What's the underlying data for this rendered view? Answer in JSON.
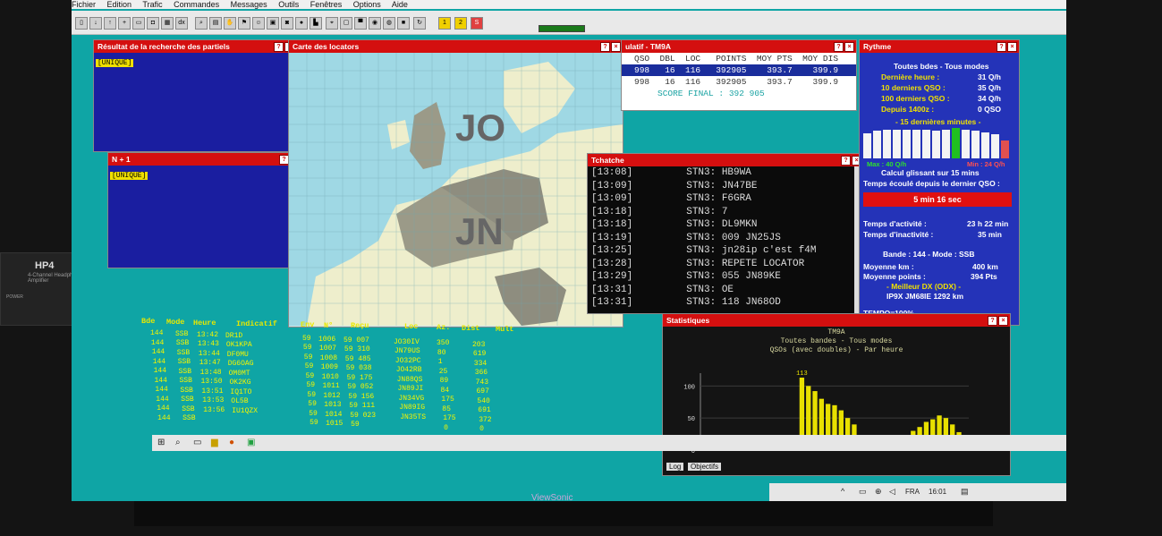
{
  "menu": [
    "Fichier",
    "Edition",
    "Trafic",
    "Commandes",
    "Messages",
    "Outils",
    "Fenêtres",
    "Options",
    "Aide"
  ],
  "amp": {
    "brand": "HP4",
    "subtitle": "4-Channel Headphone Amplifier",
    "power": "POWER"
  },
  "monitor_brand": "ViewSonic",
  "partials": {
    "title": "Résultat de la recherche des partiels",
    "tag": "[UNIQUE]"
  },
  "nplus1": {
    "title": "N + 1",
    "tag": "[UNIQUE]"
  },
  "map": {
    "title": "Carte des locators",
    "labels": [
      "JO",
      "JN"
    ]
  },
  "cumul": {
    "title": "ulatif - TM9A",
    "header": "QSO  DBL  LOC   POINTS  MOY PTS  MOY DIS",
    "rows": [
      "998   16  116   392905    393.7    399.9",
      "998   16  116   392905    393.7    399.9"
    ],
    "score": "SCORE FINAL : 392 905"
  },
  "chat": {
    "title": "Tchatche",
    "lines": [
      {
        "time": "[13:08]",
        "text": "STN3: HB9WA"
      },
      {
        "time": "[13:09]",
        "text": "STN3: JN47BE"
      },
      {
        "time": "[13:09]",
        "text": "STN3: F6GRA"
      },
      {
        "time": "[13:18]",
        "text": "STN3: 7"
      },
      {
        "time": "[13:18]",
        "text": "STN3: DL9MKN"
      },
      {
        "time": "[13:19]",
        "text": "STN3: 009 JN25JS"
      },
      {
        "time": "[13:25]",
        "text": "STN3: jn28ip c'est f4M"
      },
      {
        "time": "[13:28]",
        "text": "STN3: REPETE LOCATOR"
      },
      {
        "time": "[13:29]",
        "text": "STN3: 055 JN89KE"
      },
      {
        "time": "[13:31]",
        "text": "STN3: OE"
      },
      {
        "time": "[13:31]",
        "text": "STN3: 118 JN68OD"
      }
    ]
  },
  "rythme": {
    "title": "Rythme",
    "subtitle": "Toutes bdes - Tous modes",
    "stats": [
      {
        "label": "Dernière heure :",
        "value": "31 Q/h"
      },
      {
        "label": "10 derniers QSO :",
        "value": "35 Q/h"
      },
      {
        "label": "100 derniers QSO :",
        "value": "34 Q/h"
      },
      {
        "label": "Depuis 1400z :",
        "value": "0 QSO"
      }
    ],
    "last15": "- 15 dernières minutes -",
    "bars": [
      0.78,
      0.85,
      0.88,
      0.9,
      0.9,
      0.9,
      0.88,
      0.85,
      0.9,
      0.95,
      0.9,
      0.85,
      0.8,
      0.75,
      0.55
    ],
    "max": "Max : 40 Q/h",
    "min": "Min : 24 Q/h",
    "calc": "Calcul glissant sur 15 mins",
    "elapsed_label": "Temps écoulé depuis le dernier QSO :",
    "elapsed_value": "5 min 16 sec",
    "activity_label": "Temps d'activité :",
    "activity_value": "23 h 22 min",
    "inactivity_label": "Temps d'inactivité :",
    "inactivity_value": "35 min",
    "band": "Bande : 144 - Mode : SSB",
    "avg_km_label": "Moyenne km :",
    "avg_km_value": "400 km",
    "avg_pts_label": "Moyenne points :",
    "avg_pts_value": "394 Pts",
    "best_label": "- Meilleur DX (ODX) -",
    "best_value": "IP9X  JM68IE  1292 km",
    "tempo": "TEMPO=100%"
  },
  "log": {
    "headers": [
      "Bde",
      "Mode",
      "Heure",
      "Indicatif",
      "Env",
      "N°",
      "Reçu",
      "Loc",
      "Az.",
      "Dist",
      "Mult"
    ],
    "rows": [
      {
        "bde": "144",
        "mode": "SSB",
        "heure": "13:42",
        "call": "DR1D",
        "env": "59",
        "n": "1006",
        "recu": "59 007",
        "loc": "JO30IV",
        "az": "350",
        "dist": "203"
      },
      {
        "bde": "144",
        "mode": "SSB",
        "heure": "13:43",
        "call": "OK1KPA",
        "env": "59",
        "n": "1007",
        "recu": "59 310",
        "loc": "JN79US",
        "az": "80",
        "dist": "619"
      },
      {
        "bde": "144",
        "mode": "SSB",
        "heure": "13:44",
        "call": "DF0MU",
        "env": "59",
        "n": "1008",
        "recu": "59 485",
        "loc": "JO32PC",
        "az": "1",
        "dist": "334"
      },
      {
        "bde": "144",
        "mode": "SSB",
        "heure": "13:47",
        "call": "DG6OAG",
        "env": "59",
        "n": "1009",
        "recu": "59 038",
        "loc": "JO42RB",
        "az": "25",
        "dist": "366"
      },
      {
        "bde": "144",
        "mode": "SSB",
        "heure": "13:48",
        "call": "OM0MT",
        "env": "59",
        "n": "1010",
        "recu": "59 175",
        "loc": "JN88QS",
        "az": "89",
        "dist": "743"
      },
      {
        "bde": "144",
        "mode": "SSB",
        "heure": "13:50",
        "call": "OK2KG",
        "env": "59",
        "n": "1011",
        "recu": "59 052",
        "loc": "JN89JI",
        "az": "84",
        "dist": "697"
      },
      {
        "bde": "144",
        "mode": "SSB",
        "heure": "13:51",
        "call": "IQ1TO",
        "env": "59",
        "n": "1012",
        "recu": "59 156",
        "loc": "JN34VG",
        "az": "175",
        "dist": "540"
      },
      {
        "bde": "144",
        "mode": "SSB",
        "heure": "13:53",
        "call": "OL5B",
        "env": "59",
        "n": "1013",
        "recu": "59 111",
        "loc": "JN89IG",
        "az": "85",
        "dist": "691"
      },
      {
        "bde": "144",
        "mode": "SSB",
        "heure": "13:56",
        "call": "IU1QZX",
        "env": "59",
        "n": "1014",
        "recu": "59 023",
        "loc": "JN35TS",
        "az": "175",
        "dist": "372"
      },
      {
        "bde": "144",
        "mode": "SSB",
        "heure": "",
        "call": "",
        "env": "59",
        "n": "1015",
        "recu": "59",
        "loc": "",
        "az": "0",
        "dist": "0"
      }
    ]
  },
  "stats": {
    "title": "Statistiques",
    "chart_title": "TM9A",
    "chart_sub1": "Toutes bandes - Tous modes",
    "chart_sub2": "QSOs (avec doubles) - Par heure",
    "peak_label": "113",
    "tabs": [
      "Log",
      "Objectifs"
    ]
  },
  "chart_data": {
    "type": "bar",
    "title": "TM9A",
    "ylim": [
      0,
      120
    ],
    "yticks": [
      0,
      50,
      100
    ],
    "values": [
      0,
      0,
      0,
      0,
      0,
      0,
      0,
      0,
      0,
      0,
      0,
      0,
      0,
      0,
      0,
      113,
      100,
      92,
      80,
      72,
      70,
      62,
      50,
      40,
      22,
      12,
      18,
      8,
      14,
      12,
      16,
      22,
      30,
      36,
      44,
      48,
      54,
      50,
      40,
      28,
      16
    ],
    "color": "#e8e000"
  },
  "taskbar": {
    "lang": "FRA",
    "time": "16:01"
  }
}
